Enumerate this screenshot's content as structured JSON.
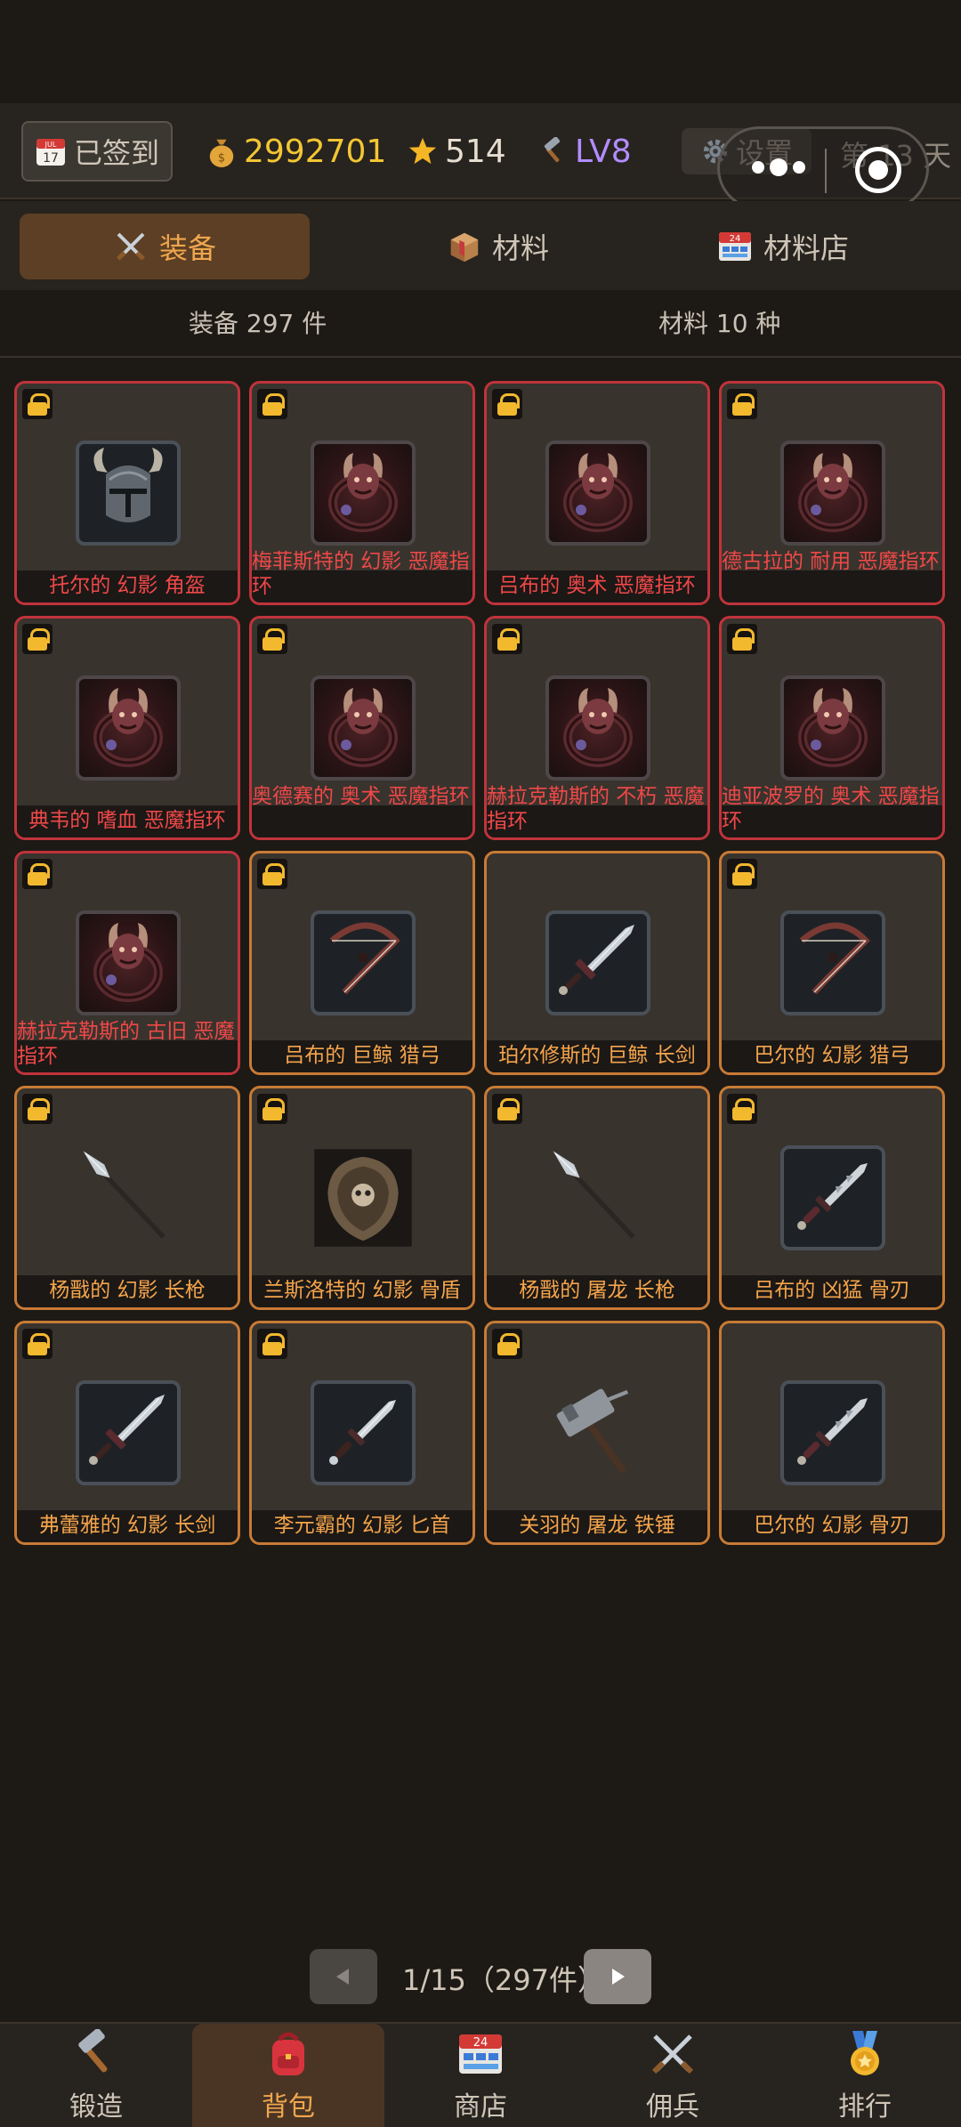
{
  "header": {
    "signin_label": "已签到",
    "calendar_month": "JUL",
    "calendar_day": "17",
    "gold": "2992701",
    "stars": "514",
    "level": "LV8",
    "settings_label": "设置",
    "day_label": "第 13 天"
  },
  "tabs": [
    {
      "label": "装备"
    },
    {
      "label": "材料"
    },
    {
      "label": "材料店"
    }
  ],
  "counts": {
    "equipment": "装备 297 件",
    "materials": "材料 10 种"
  },
  "items": [
    {
      "name": "托尔的 幻影 角盔",
      "rarity": "red",
      "icon": "horned-helmet-icon",
      "locked": true
    },
    {
      "name": "梅菲斯特的 幻影 恶魔指环",
      "rarity": "red",
      "icon": "demon-ring-icon",
      "locked": true
    },
    {
      "name": "吕布的 奥术 恶魔指环",
      "rarity": "red",
      "icon": "demon-ring-icon",
      "locked": true
    },
    {
      "name": "德古拉的 耐用 恶魔指环",
      "rarity": "red",
      "icon": "demon-ring-icon",
      "locked": true
    },
    {
      "name": "典韦的 嗜血 恶魔指环",
      "rarity": "red",
      "icon": "demon-ring-icon",
      "locked": true
    },
    {
      "name": "奥德赛的 奥术 恶魔指环",
      "rarity": "red",
      "icon": "demon-ring-icon",
      "locked": true
    },
    {
      "name": "赫拉克勒斯的 不朽 恶魔指环",
      "rarity": "red",
      "icon": "demon-ring-icon",
      "locked": true
    },
    {
      "name": "迪亚波罗的 奥术 恶魔指环",
      "rarity": "red",
      "icon": "demon-ring-icon",
      "locked": true
    },
    {
      "name": "赫拉克勒斯的 古旧 恶魔指环",
      "rarity": "red",
      "icon": "demon-ring-icon",
      "locked": true
    },
    {
      "name": "吕布的 巨鲸 猎弓",
      "rarity": "orange",
      "icon": "bow-icon",
      "locked": true
    },
    {
      "name": "珀尔修斯的 巨鲸 长剑",
      "rarity": "orange",
      "icon": "longsword-icon",
      "locked": false
    },
    {
      "name": "巴尔的 幻影 猎弓",
      "rarity": "orange",
      "icon": "bow-icon",
      "locked": true
    },
    {
      "name": "杨戬的 幻影 长枪",
      "rarity": "orange",
      "icon": "spear-icon",
      "locked": true
    },
    {
      "name": "兰斯洛特的 幻影 骨盾",
      "rarity": "orange",
      "icon": "bone-shield-icon",
      "locked": true
    },
    {
      "name": "杨戬的 屠龙 长枪",
      "rarity": "orange",
      "icon": "spear-icon",
      "locked": true
    },
    {
      "name": "吕布的 凶猛 骨刃",
      "rarity": "orange",
      "icon": "bone-blade-icon",
      "locked": true
    },
    {
      "name": "弗蕾雅的 幻影 长剑",
      "rarity": "orange",
      "icon": "longsword-icon",
      "locked": true
    },
    {
      "name": "李元霸的 幻影 匕首",
      "rarity": "orange",
      "icon": "dagger-icon",
      "locked": true
    },
    {
      "name": "关羽的 屠龙 铁锤",
      "rarity": "orange",
      "icon": "warhammer-icon",
      "locked": true
    },
    {
      "name": "巴尔的 幻影 骨刃",
      "rarity": "orange",
      "icon": "bone-blade-icon",
      "locked": false
    }
  ],
  "pager": {
    "info": "1/15（297件）",
    "prev_icon": "triangle-left-icon",
    "next_icon": "triangle-right-icon"
  },
  "nav": [
    {
      "label": "锻造",
      "icon": "hammer-icon"
    },
    {
      "label": "背包",
      "icon": "backpack-icon"
    },
    {
      "label": "商店",
      "icon": "shop-icon"
    },
    {
      "label": "佣兵",
      "icon": "crossed-swords-icon"
    },
    {
      "label": "排行",
      "icon": "medal-icon"
    }
  ],
  "colors": {
    "rare_red": "#f04848",
    "epic_orange": "#f5a44b",
    "gold_text": "#f3c633",
    "level_purple": "#b38cff"
  }
}
